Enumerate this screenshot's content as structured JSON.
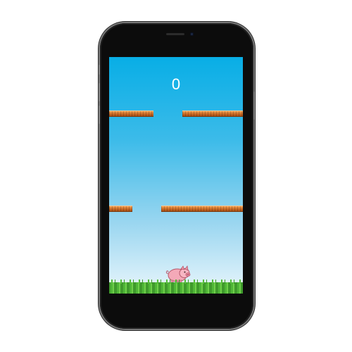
{
  "game": {
    "score": "0",
    "sprites": {
      "player": "pig-icon"
    },
    "colors": {
      "sky_top": "#08aee6",
      "sky_bottom": "#e9f6fc",
      "platform": "#d06f27",
      "grass": "#4aa832"
    }
  }
}
